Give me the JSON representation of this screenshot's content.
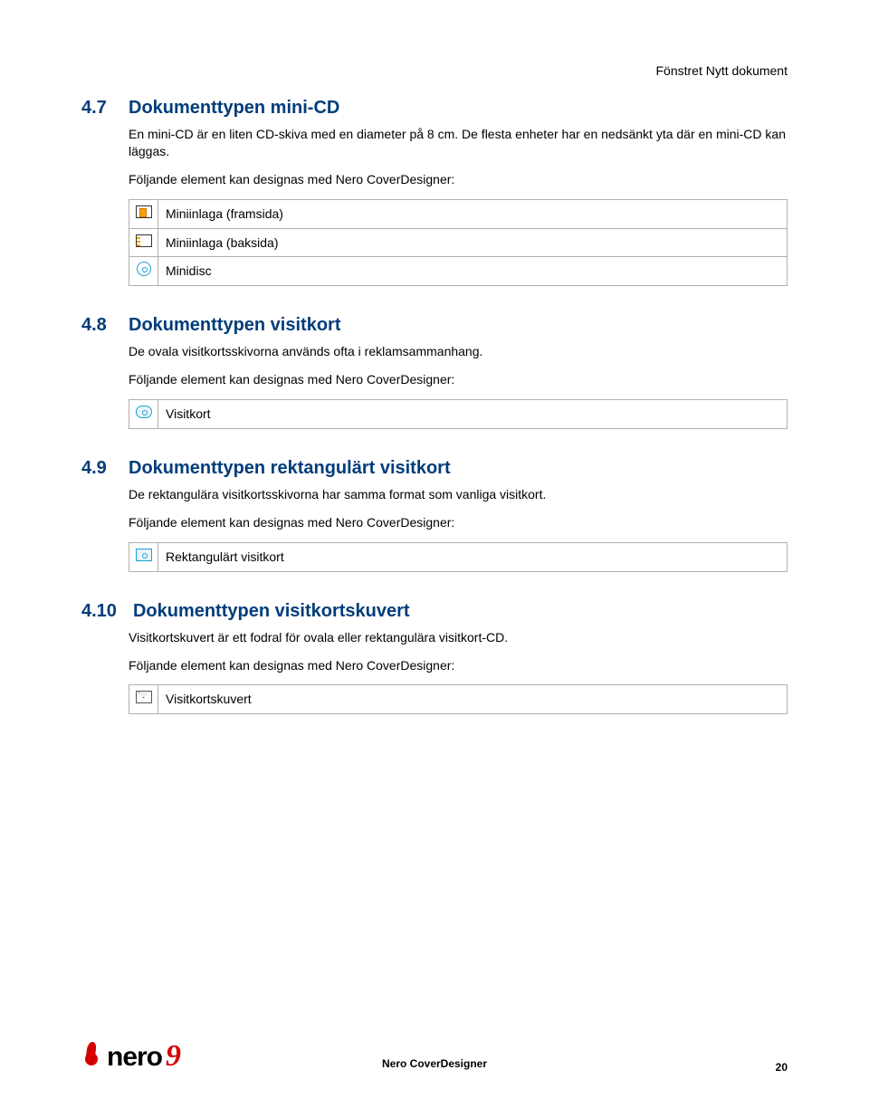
{
  "header": {
    "right": "Fönstret Nytt dokument"
  },
  "sections": [
    {
      "number": "4.7",
      "title": "Dokumenttypen mini-CD",
      "para1": "En mini-CD är en liten CD-skiva med en diameter på 8 cm. De flesta enheter har en nedsänkt yta där en mini-CD kan läggas.",
      "para2": "Följande element kan designas med Nero CoverDesigner:",
      "rows": [
        {
          "label": "Miniinlaga (framsida)"
        },
        {
          "label": "Miniinlaga (baksida)"
        },
        {
          "label": "Minidisc"
        }
      ]
    },
    {
      "number": "4.8",
      "title": "Dokumenttypen visitkort",
      "para1": "De ovala visitkortsskivorna används ofta i reklamsammanhang.",
      "para2": "Följande element kan designas med Nero CoverDesigner:",
      "rows": [
        {
          "label": "Visitkort"
        }
      ]
    },
    {
      "number": "4.9",
      "title": "Dokumenttypen rektangulärt visitkort",
      "para1": "De rektangulära visitkortsskivorna har samma format som vanliga visitkort.",
      "para2": "Följande element kan designas med Nero CoverDesigner:",
      "rows": [
        {
          "label": "Rektangulärt visitkort"
        }
      ]
    },
    {
      "number": "4.10",
      "title": "Dokumenttypen visitkortskuvert",
      "para1": "Visitkortskuvert är ett fodral för ovala eller rektangulära visitkort-CD.",
      "para2": "Följande element kan designas med Nero CoverDesigner:",
      "rows": [
        {
          "label": "Visitkortskuvert"
        }
      ]
    }
  ],
  "footer": {
    "logo_text": "nero",
    "logo_version": "9",
    "center": "Nero CoverDesigner",
    "page": "20"
  }
}
